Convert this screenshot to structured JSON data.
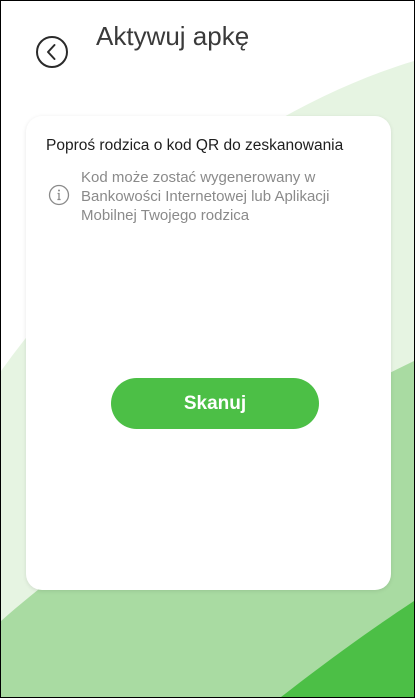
{
  "header": {
    "title": "Aktywuj apkę",
    "back_icon": "chevron-left-circle-icon"
  },
  "card": {
    "heading": "Poproś rodzica o kod QR do zeskanowania",
    "info_icon": "info-icon",
    "info_text": "Kod może zostać wygenerowany w Bankowości Internetowej lub Aplikacji Mobilnej Twojego rodzica",
    "scan_label": "Skanuj"
  },
  "colors": {
    "accent": "#4cbf46",
    "background_wave_light": "#e4f3e0",
    "background_wave_mid": "#a7d9a0",
    "background_wave_dark": "#4cbf46"
  }
}
